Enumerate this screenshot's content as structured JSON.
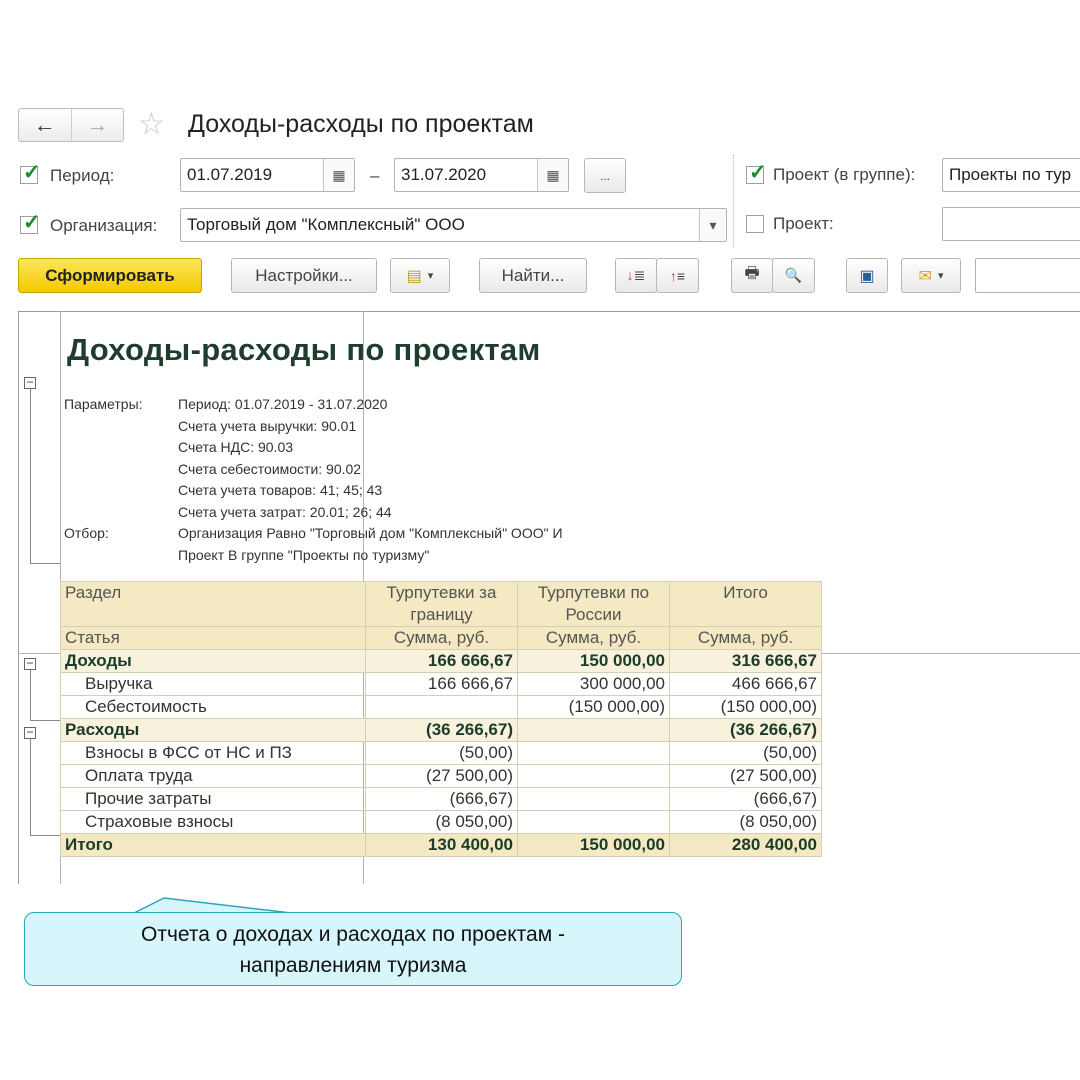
{
  "window": {
    "title": "Доходы-расходы по проектам"
  },
  "nav": {
    "back_icon": "←",
    "forward_icon": "→"
  },
  "filters": {
    "period_label": "Период:",
    "date_from": "01.07.2019",
    "date_dash": "–",
    "date_to": "31.07.2020",
    "more_label": "...",
    "org_label": "Организация:",
    "org_value": "Торговый дом \"Комплексный\" ООО",
    "project_group_label": "Проект (в группе):",
    "project_group_value": "Проекты по тур",
    "project_label": "Проект:",
    "project_value": ""
  },
  "toolbar": {
    "generate": "Сформировать",
    "settings": "Настройки...",
    "find": "Найти..."
  },
  "report": {
    "title": "Доходы-расходы по проектам",
    "params_label": "Параметры:",
    "params": [
      "Период: 01.07.2019 - 31.07.2020",
      "Счета учета выручки: 90.01",
      "Счета НДС: 90.03",
      "Счета себестоимости: 90.02",
      "Счета учета товаров: 41; 45; 43",
      "Счета учета затрат: 20.01; 26; 44"
    ],
    "filter_label": "Отбор:",
    "filters": [
      "Организация Равно \"Торговый дом \"Комплексный\" ООО\" И",
      "Проект В группе \"Проекты по туризму\""
    ],
    "table": {
      "head_section": "Раздел",
      "head_article": "Статья",
      "col1_line1": "Турпутевки за",
      "col1_line2": "границу",
      "col2_line1": "Турпутевки по",
      "col2_line2": "России",
      "col3": "Итого",
      "unit": "Сумма, руб.",
      "rows": [
        {
          "label": "Доходы",
          "v1": "166 666,67",
          "v2": "150 000,00",
          "v3": "316 666,67"
        },
        {
          "label": "Выручка",
          "v1": "166 666,67",
          "v2": "300 000,00",
          "v3": "466 666,67"
        },
        {
          "label": "Себестоимость",
          "v1": "",
          "v2": "(150 000,00)",
          "v3": "(150 000,00)"
        },
        {
          "label": "Расходы",
          "v1": "(36 266,67)",
          "v2": "",
          "v3": "(36 266,67)"
        },
        {
          "label": "Взносы в ФСС от НС и ПЗ",
          "v1": "(50,00)",
          "v2": "",
          "v3": "(50,00)"
        },
        {
          "label": "Оплата труда",
          "v1": "(27 500,00)",
          "v2": "",
          "v3": "(27 500,00)"
        },
        {
          "label": "Прочие затраты",
          "v1": "(666,67)",
          "v2": "",
          "v3": "(666,67)"
        },
        {
          "label": "Страховые взносы",
          "v1": "(8 050,00)",
          "v2": "",
          "v3": "(8 050,00)"
        },
        {
          "label": "Итого",
          "v1": "130 400,00",
          "v2": "150 000,00",
          "v3": "280 400,00"
        }
      ]
    }
  },
  "callout": {
    "line1": "Отчета о доходах и расходах по проектам -",
    "line2": "направлениям туризма"
  }
}
